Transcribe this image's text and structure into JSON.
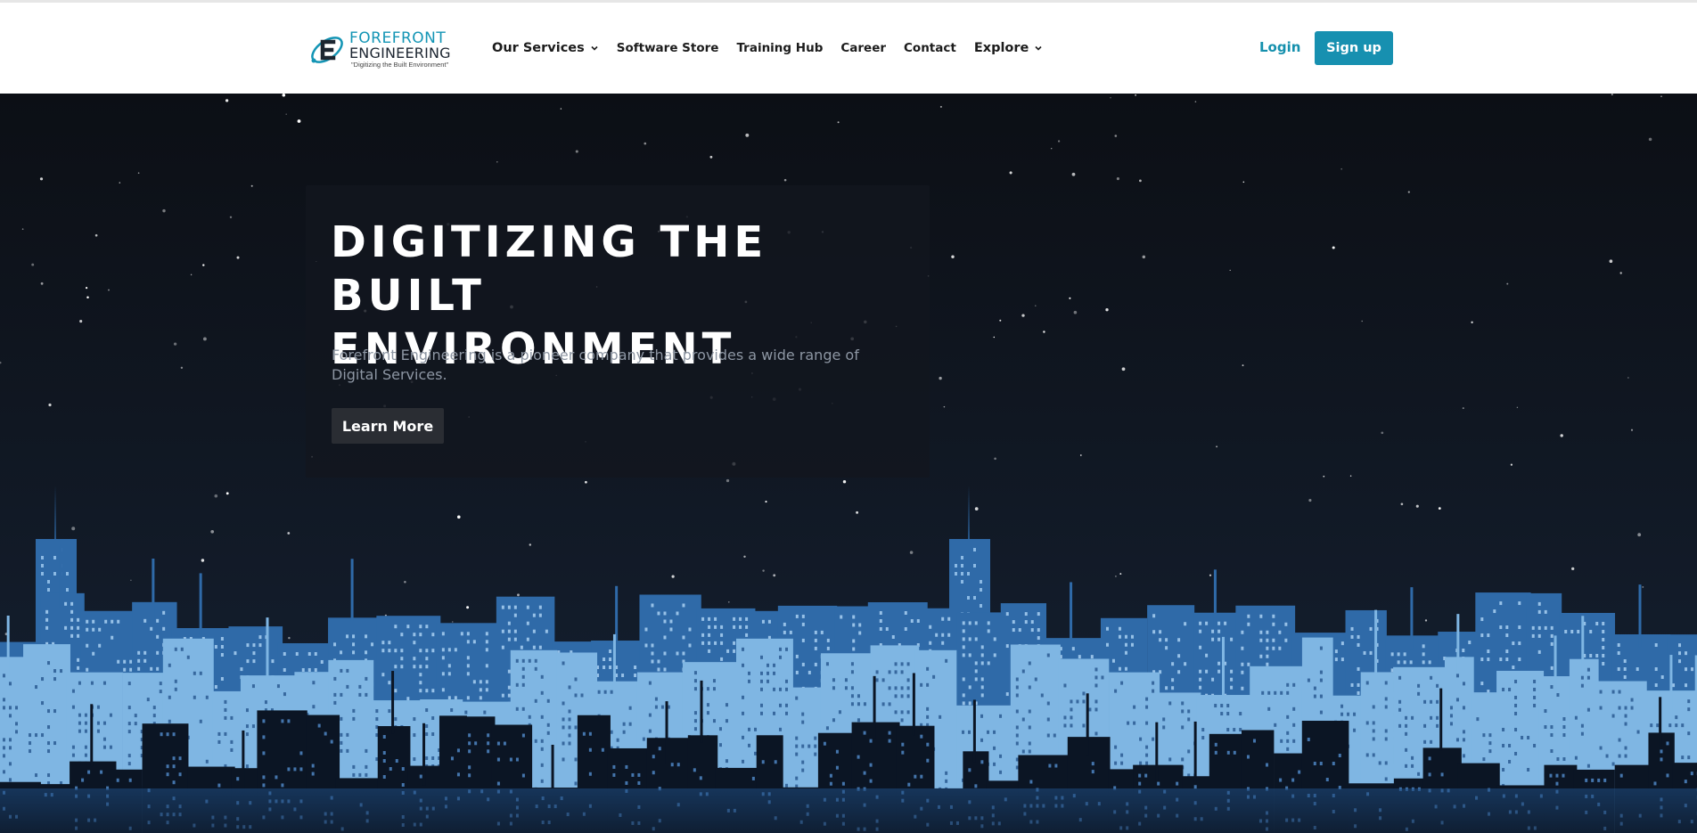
{
  "brand": {
    "name_line1": "FOREFRONT",
    "name_line2": "ENGINEERING",
    "tagline": "\"Digitizing the Built Environment\"",
    "logo_icon": "orbit-e-logo-icon",
    "color_primary": "#1495b5",
    "color_dark": "#1c2530"
  },
  "nav": {
    "items": [
      {
        "label": "Our Services",
        "has_dropdown": true
      },
      {
        "label": "Software Store",
        "has_dropdown": false
      },
      {
        "label": "Training Hub",
        "has_dropdown": false
      },
      {
        "label": "Career",
        "has_dropdown": false
      },
      {
        "label": "Contact",
        "has_dropdown": false
      },
      {
        "label": "Explore",
        "has_dropdown": true
      }
    ],
    "login_label": "Login",
    "signup_label": "Sign up",
    "dropdown_icon": "chevron-down-icon"
  },
  "hero": {
    "title": "DIGITIZING THE BUILT ENVIRONMENT",
    "description": "Forefront Engineering is a pioneer company that provides a wide range of Digital Services.",
    "cta_label": "Learn More",
    "background": "night-city-skyline",
    "colors": {
      "sky_top": "#0c0f15",
      "sky_bottom": "#152133",
      "building_light": "#7fb6e3",
      "building_mid": "#2f6aa8",
      "building_dark": "#0b1524"
    }
  }
}
